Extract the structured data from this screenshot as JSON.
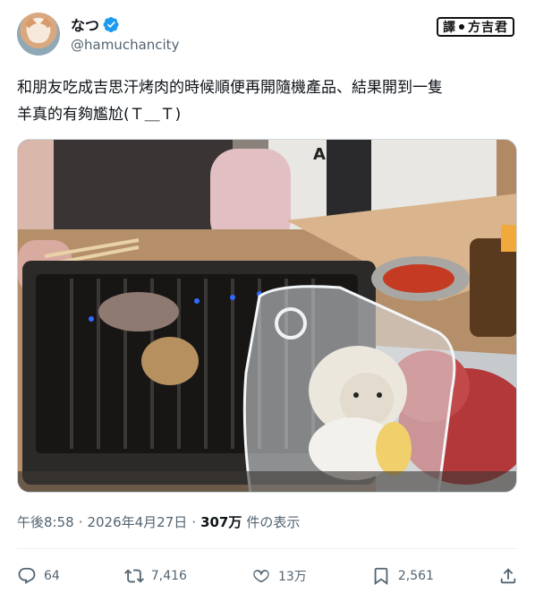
{
  "author": {
    "display_name": "なつ",
    "handle": "@hamuchancity"
  },
  "watermark": {
    "part1": "譯",
    "part2": "方吉君"
  },
  "tweet": {
    "line1": "和朋友吃成吉思汗烤肉的時候順便再開隨機產品、結果開到一隻",
    "line2": "羊真的有夠尷尬(Ｔ＿Ｔ)"
  },
  "meta": {
    "time": "午後8:58",
    "sep1": "·",
    "date": "2026年4月27日",
    "sep2": "·",
    "views": "307万",
    "views_label": "件の表示"
  },
  "actions": {
    "replies": "64",
    "reposts": "7,416",
    "likes": "13万",
    "bookmarks": "2,561"
  },
  "icons": {
    "reply": "reply-icon",
    "repost": "repost-icon",
    "like": "heart-icon",
    "bookmark": "bookmark-icon",
    "share": "share-icon",
    "verified": "verified-badge-icon"
  },
  "colors": {
    "text": "#0f1419",
    "secondary": "#536471",
    "verified": "#1d9bf0"
  }
}
